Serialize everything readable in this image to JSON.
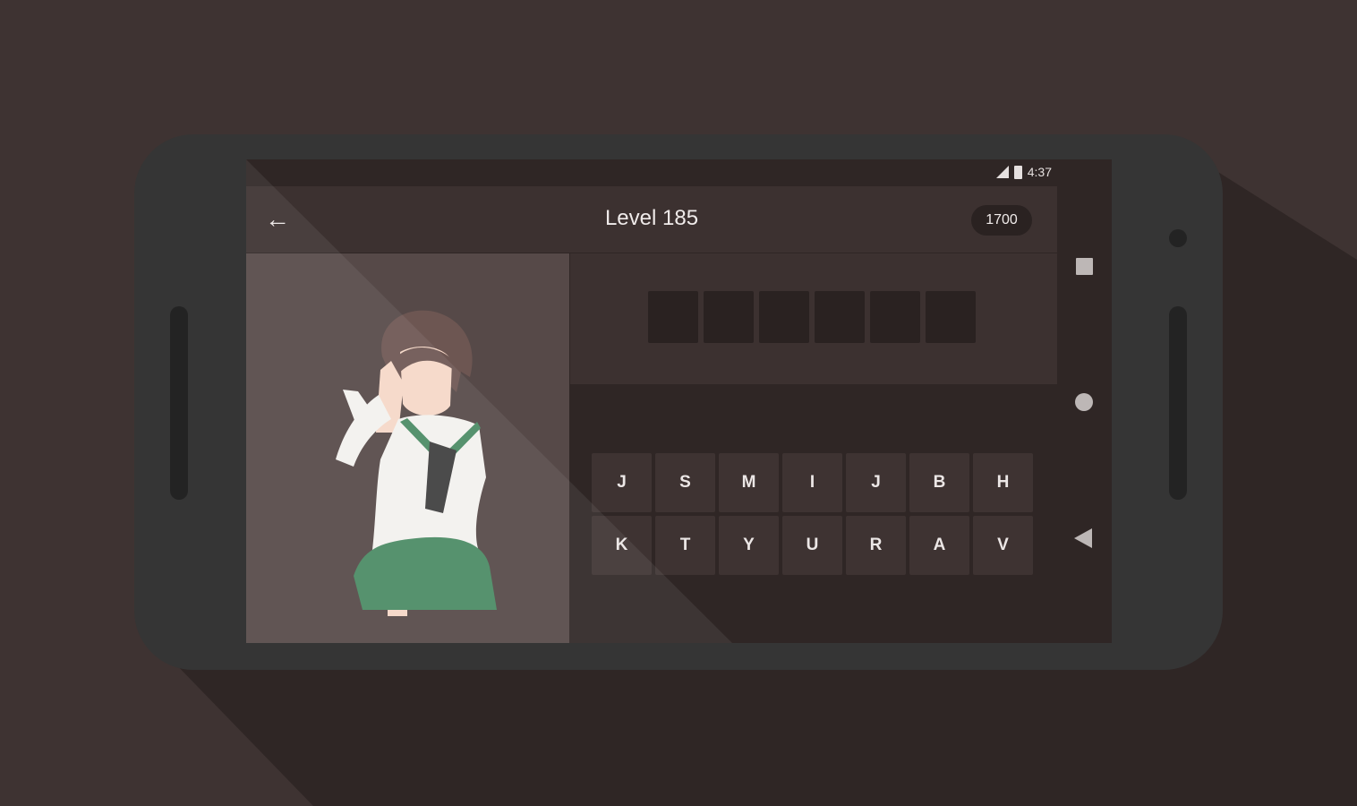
{
  "status_bar": {
    "time": "4:37",
    "signal_icon": "signal-icon",
    "battery_icon": "battery-icon"
  },
  "app_bar": {
    "back_icon": "arrow-left-icon",
    "title": "Level 185",
    "coins": "1700"
  },
  "answer": {
    "slot_count": 6
  },
  "keyboard": {
    "rows": [
      [
        "J",
        "S",
        "M",
        "I",
        "J",
        "B",
        "H"
      ],
      [
        "K",
        "T",
        "Y",
        "U",
        "R",
        "A",
        "V"
      ]
    ]
  },
  "nav_bar": {
    "recent_icon": "square-icon",
    "home_icon": "circle-icon",
    "back_icon": "triangle-back-icon"
  },
  "colors": {
    "background": "#3e3332",
    "phone_body": "#353535",
    "screen_dark": "#2f2625",
    "panel": "#3c3130",
    "image_panel": "#564948",
    "skirt_green": "#4a8a63"
  }
}
